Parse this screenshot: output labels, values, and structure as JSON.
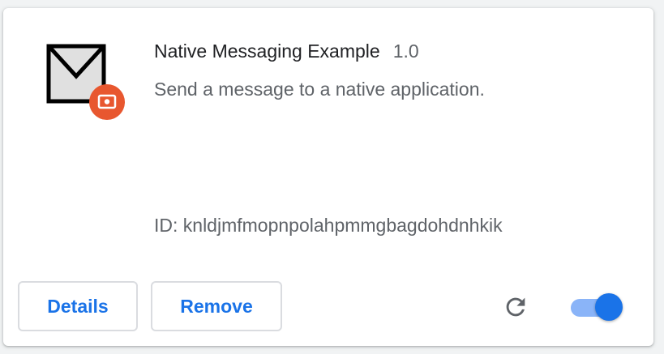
{
  "extension": {
    "name": "Native Messaging Example",
    "version": "1.0",
    "description": "Send a message to a native application.",
    "id_label": "ID: knldjmfmopnpolahpmmgbagdohdnhkik",
    "icon": "envelope-icon",
    "badge_icon": "native-app-badge-icon",
    "enabled": true
  },
  "actions": {
    "details_label": "Details",
    "remove_label": "Remove",
    "reload_icon": "reload-icon"
  },
  "colors": {
    "accent": "#1a73e8",
    "toggle_track": "#8ab4f8",
    "badge": "#e8572f",
    "text_primary": "#202124",
    "text_secondary": "#5f6368"
  }
}
